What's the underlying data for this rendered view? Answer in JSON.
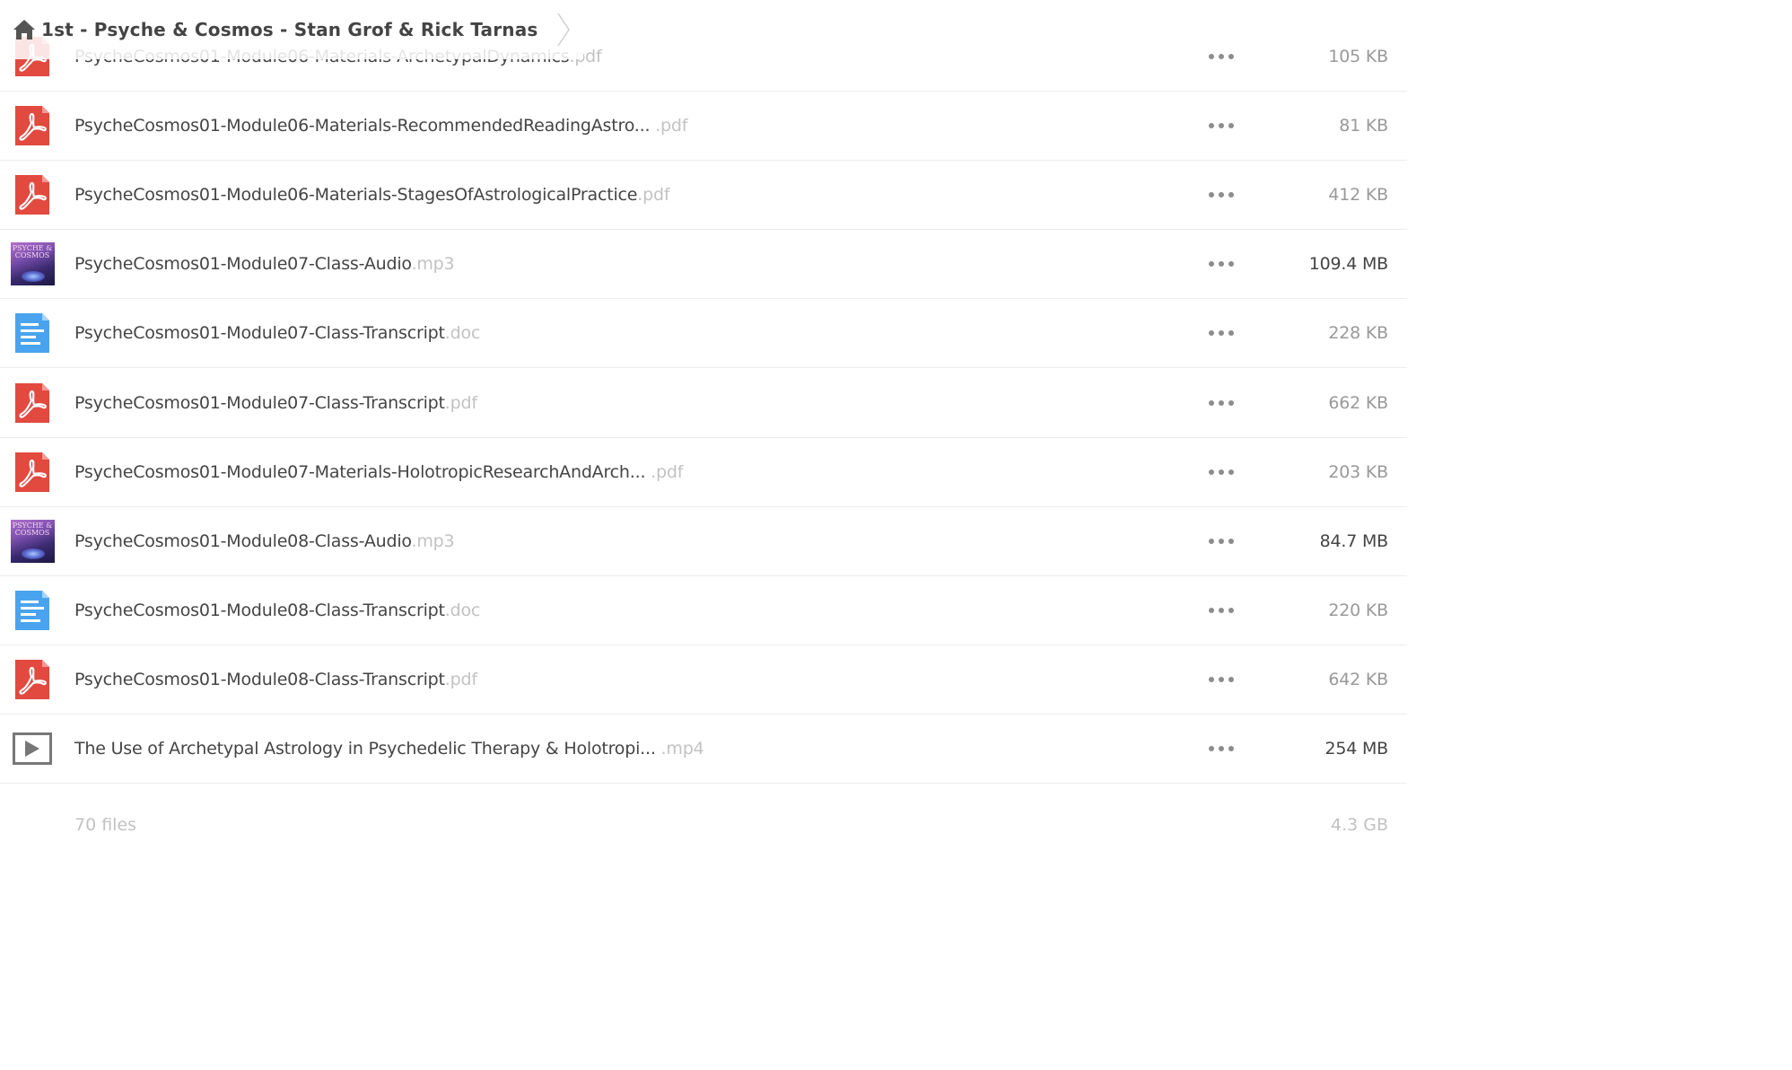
{
  "breadcrumb": {
    "home_icon": "home-icon",
    "title": "1st - Psyche & Cosmos - Stan Grof & Rick Tarnas"
  },
  "files": [
    {
      "name": "PsycheCosmos01-Module06-Materials-ArchetypalDynamics",
      "ext": ".pdf",
      "size": "105 KB",
      "type": "pdf"
    },
    {
      "name": "PsycheCosmos01-Module06-Materials-RecommendedReadingAstro...",
      "ext": " .pdf",
      "size": "81 KB",
      "type": "pdf"
    },
    {
      "name": "PsycheCosmos01-Module06-Materials-StagesOfAstrologicalPractice",
      "ext": ".pdf",
      "size": "412 KB",
      "type": "pdf"
    },
    {
      "name": "PsycheCosmos01-Module07-Class-Audio",
      "ext": ".mp3",
      "size": "109.4 MB",
      "type": "mp3"
    },
    {
      "name": "PsycheCosmos01-Module07-Class-Transcript",
      "ext": ".doc",
      "size": "228 KB",
      "type": "doc"
    },
    {
      "name": "PsycheCosmos01-Module07-Class-Transcript",
      "ext": ".pdf",
      "size": "662 KB",
      "type": "pdf"
    },
    {
      "name": "PsycheCosmos01-Module07-Materials-HolotropicResearchAndArch...",
      "ext": " .pdf",
      "size": "203 KB",
      "type": "pdf"
    },
    {
      "name": "PsycheCosmos01-Module08-Class-Audio",
      "ext": ".mp3",
      "size": "84.7 MB",
      "type": "mp3"
    },
    {
      "name": "PsycheCosmos01-Module08-Class-Transcript",
      "ext": ".doc",
      "size": "220 KB",
      "type": "doc"
    },
    {
      "name": "PsycheCosmos01-Module08-Class-Transcript",
      "ext": ".pdf",
      "size": "642 KB",
      "type": "pdf"
    },
    {
      "name": "The Use of Archetypal Astrology in Psychedelic Therapy & Holotropi...",
      "ext": " .mp4",
      "size": "254 MB",
      "type": "mp4"
    }
  ],
  "album_art_text": "PSYCHE & COSMOS",
  "footer": {
    "count": "70 files",
    "total": "4.3 GB"
  },
  "colors": {
    "pdf_red": "#e2493f",
    "doc_blue": "#4aa3ee",
    "ext_gray": "#c2c2c2",
    "text": "#444444",
    "divider": "#ececec"
  }
}
